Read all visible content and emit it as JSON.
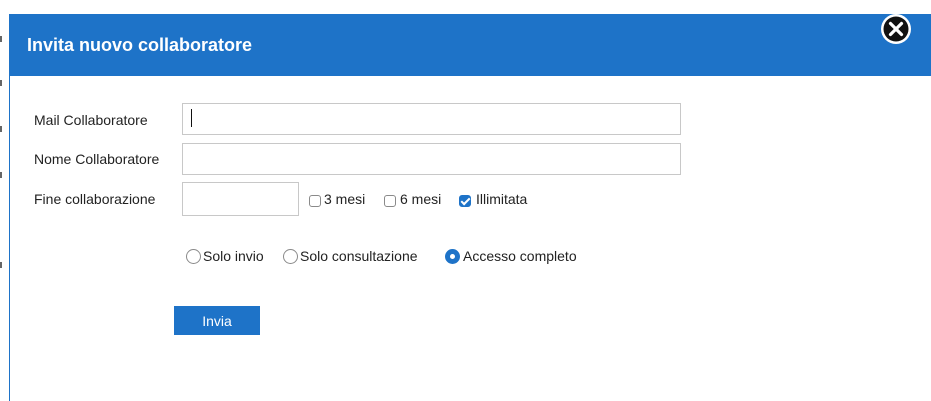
{
  "dialog": {
    "title": "Invita nuovo collaboratore",
    "close_icon": "close-circle-icon"
  },
  "form": {
    "mail_label": "Mail Collaboratore",
    "mail_value": "",
    "name_label": "Nome Collaboratore",
    "name_value": "",
    "end_label": "Fine collaborazione",
    "end_value": "",
    "duration_options": [
      {
        "label": "3 mesi",
        "checked": false
      },
      {
        "label": "6 mesi",
        "checked": false
      },
      {
        "label": "Illimitata",
        "checked": true
      }
    ],
    "access_options": [
      {
        "label": "Solo invio",
        "selected": false
      },
      {
        "label": "Solo consultazione",
        "selected": false
      },
      {
        "label": "Accesso completo",
        "selected": true
      }
    ],
    "submit_label": "Invia"
  },
  "colors": {
    "accent": "#1e73c8",
    "title_text": "#ffffff"
  }
}
